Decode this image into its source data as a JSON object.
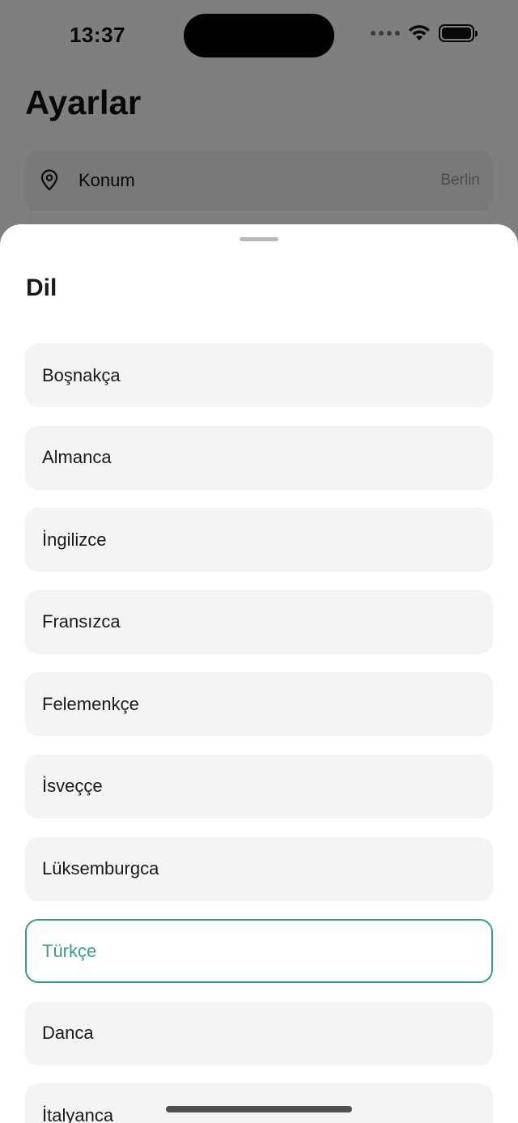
{
  "status_bar": {
    "time": "13:37"
  },
  "settings": {
    "title": "Ayarlar",
    "location_label": "Konum",
    "location_value": "Berlin"
  },
  "sheet": {
    "title": "Dil",
    "languages": [
      {
        "label": "Boşnakça",
        "selected": false
      },
      {
        "label": "Almanca",
        "selected": false
      },
      {
        "label": "İngilizce",
        "selected": false
      },
      {
        "label": "Fransızca",
        "selected": false
      },
      {
        "label": "Felemenkçe",
        "selected": false
      },
      {
        "label": "İsveççe",
        "selected": false
      },
      {
        "label": "Lüksemburgca",
        "selected": false
      },
      {
        "label": "Türkçe",
        "selected": true
      },
      {
        "label": "Danca",
        "selected": false
      },
      {
        "label": "İtalyanca",
        "selected": false
      }
    ]
  },
  "colors": {
    "accent": "#3a9c89",
    "item_background": "#f4f4f4",
    "overlay": "rgba(0,0,0,0.5)"
  }
}
